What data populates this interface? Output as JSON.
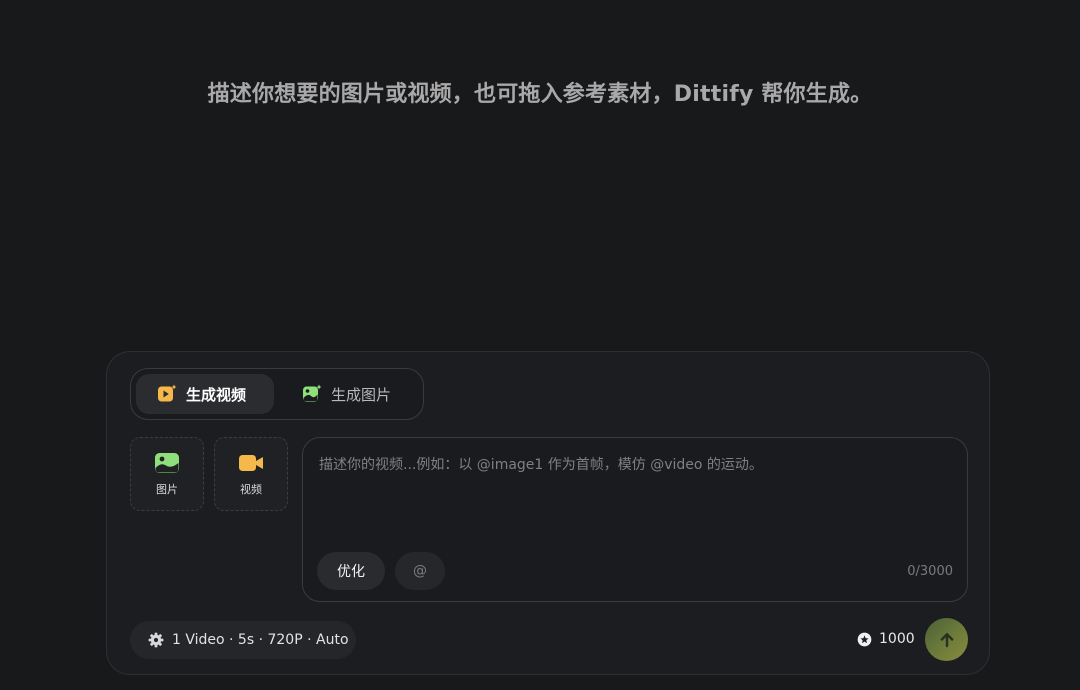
{
  "headline": "描述你想要的图片或视频，也可拖入参考素材，Dittify 帮你生成。",
  "mode_tabs": {
    "video": {
      "label": "生成视频",
      "icon": "video-generate-icon",
      "active": true
    },
    "image": {
      "label": "生成图片",
      "icon": "image-generate-icon",
      "active": false
    }
  },
  "assets": {
    "image": {
      "label": "图片",
      "icon": "image-upload-icon"
    },
    "video": {
      "label": "视频",
      "icon": "video-camera-icon"
    }
  },
  "prompt": {
    "value": "",
    "placeholder": "描述你的视频...例如：以 @image1 作为首帧，模仿 @video 的运动。",
    "counter": "0/3000"
  },
  "chips": {
    "optimize": "优化",
    "mention": "@"
  },
  "settings": {
    "summary": "1 Video · 5s · 720P · Auto",
    "icon": "gear-icon"
  },
  "credits": {
    "amount": "1000",
    "icon": "credit-coin-icon"
  },
  "send": {
    "icon": "arrow-up-icon"
  },
  "colors": {
    "background": "#18191b",
    "panel": "#1c1d20",
    "accent_yellow": "#f5b84b",
    "accent_green": "#8fe07a",
    "send_gradient_start": "#4b5f38",
    "send_gradient_end": "#8a8a3c"
  }
}
